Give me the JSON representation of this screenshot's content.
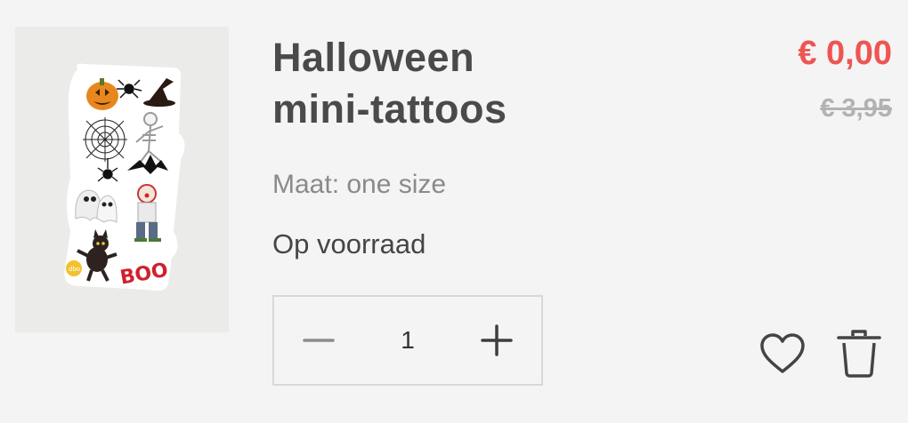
{
  "product": {
    "title_line1": "Halloween",
    "title_line2": "mini-tattoos",
    "size_text": "Maat: one size",
    "stock_text": "Op voorraad",
    "image_alt": "Halloween mini-tattoos sheet",
    "image_stickers": [
      "pumpkin",
      "spider",
      "witch-hat",
      "spiderweb",
      "skeleton",
      "hanging-spider",
      "bat",
      "ghosts",
      "clown",
      "black-cat",
      "BOO"
    ]
  },
  "price": {
    "current": "€ 0,00",
    "original": "€ 3,95",
    "current_color": "#ee5552",
    "original_color": "#b2b2b2"
  },
  "quantity": {
    "value": "1",
    "decrement_icon": "minus-icon",
    "increment_icon": "plus-icon"
  },
  "actions": {
    "wishlist_icon": "heart-icon",
    "remove_icon": "trash-icon"
  }
}
